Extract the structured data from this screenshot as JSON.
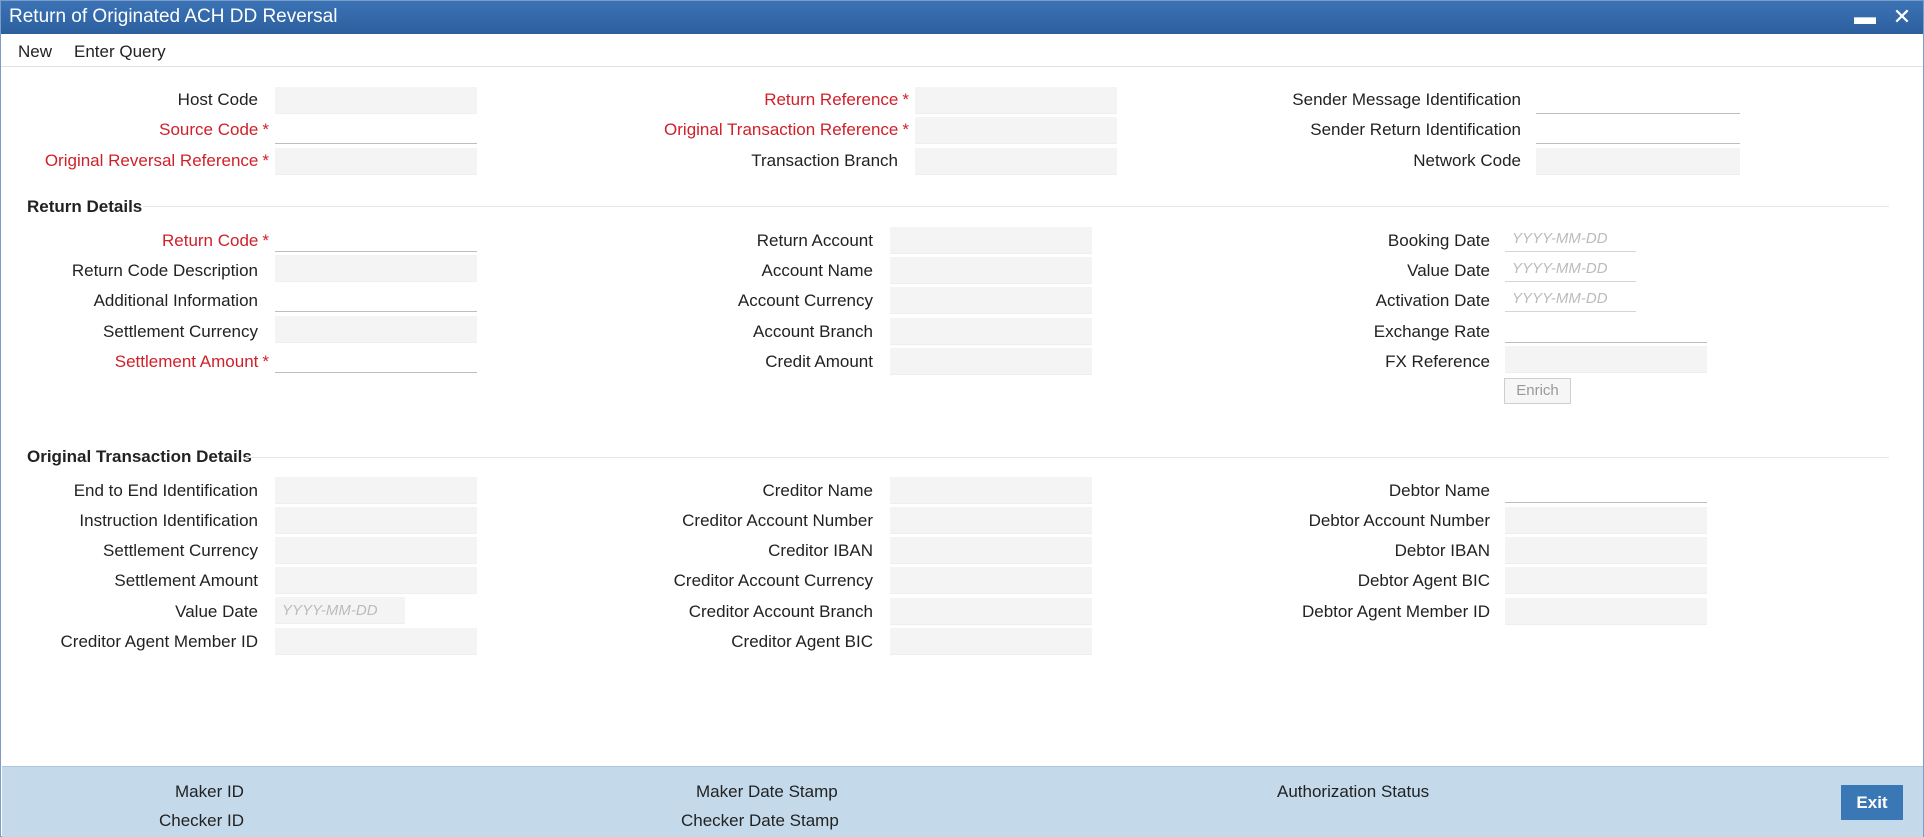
{
  "window": {
    "title": "Return of Originated ACH DD Reversal",
    "minimize_icon": "minimize-icon",
    "close_icon": "close-icon"
  },
  "menu": {
    "new_label": "New",
    "enter_query_label": "Enter Query"
  },
  "header": {
    "host_code": "Host Code",
    "source_code": "Source Code",
    "original_reversal_reference": "Original Reversal Reference",
    "return_reference": "Return Reference",
    "original_transaction_reference": "Original Transaction Reference",
    "transaction_branch": "Transaction Branch",
    "sender_message_identification": "Sender Message Identification",
    "sender_return_identification": "Sender Return Identification",
    "network_code": "Network Code",
    "required_mark": "*"
  },
  "return_details": {
    "title": "Return Details",
    "return_code": "Return Code",
    "return_code_description": "Return Code Description",
    "additional_information": "Additional Information",
    "settlement_currency": "Settlement Currency",
    "settlement_amount": "Settlement Amount",
    "return_account": "Return Account",
    "account_name": "Account Name",
    "account_currency": "Account Currency",
    "account_branch": "Account Branch",
    "credit_amount": "Credit Amount",
    "booking_date": "Booking Date",
    "value_date": "Value Date",
    "activation_date": "Activation Date",
    "exchange_rate": "Exchange Rate",
    "fx_reference": "FX Reference",
    "enrich_label": "Enrich",
    "date_placeholder": "YYYY-MM-DD"
  },
  "original_transaction_details": {
    "title": "Original Transaction Details",
    "end_to_end_identification": "End to End Identification",
    "instruction_identification": "Instruction Identification",
    "settlement_currency": "Settlement Currency",
    "settlement_amount": "Settlement Amount",
    "value_date": "Value Date",
    "creditor_agent_member_id": "Creditor Agent Member ID",
    "creditor_name": "Creditor Name",
    "creditor_account_number": "Creditor Account Number",
    "creditor_iban": "Creditor IBAN",
    "creditor_account_currency": "Creditor Account Currency",
    "creditor_account_branch": "Creditor Account Branch",
    "creditor_agent_bic": "Creditor Agent BIC",
    "debtor_name": "Debtor Name",
    "debtor_account_number": "Debtor Account Number",
    "debtor_iban": "Debtor IBAN",
    "debtor_agent_bic": "Debtor Agent BIC",
    "debtor_agent_member_id": "Debtor Agent Member ID",
    "date_placeholder": "YYYY-MM-DD"
  },
  "footer": {
    "maker_id": "Maker ID",
    "checker_id": "Checker ID",
    "maker_date_stamp": "Maker Date Stamp",
    "checker_date_stamp": "Checker Date Stamp",
    "authorization_status": "Authorization Status",
    "exit_label": "Exit"
  }
}
